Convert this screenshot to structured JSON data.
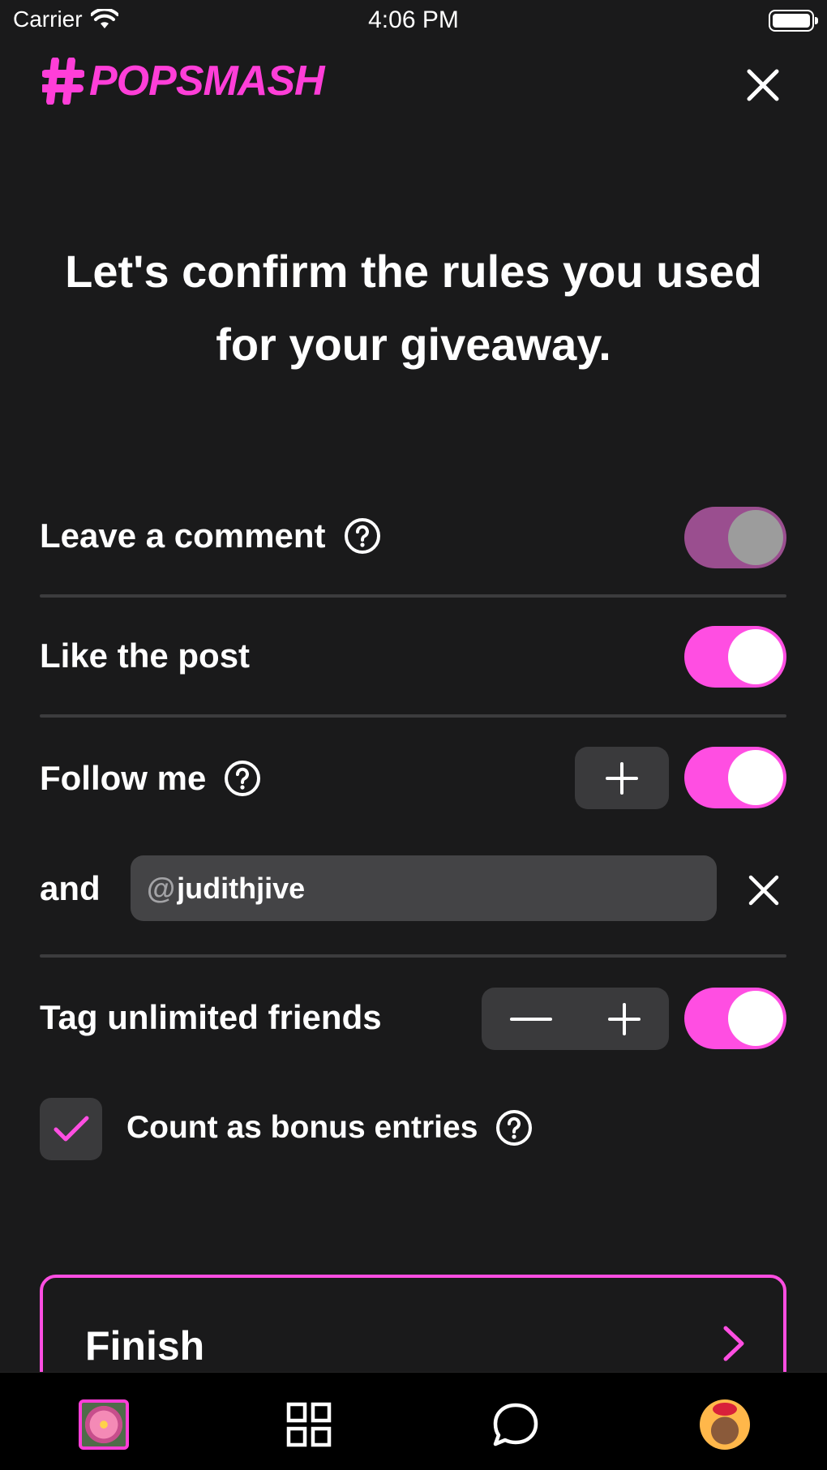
{
  "status_bar": {
    "carrier": "Carrier",
    "time": "4:06 PM"
  },
  "header": {
    "logo_text": "POPSMASH"
  },
  "headline": "Let's confirm the rules you used for your giveaway.",
  "rules": {
    "comment": {
      "label": "Leave a comment",
      "enabled": true,
      "locked": true
    },
    "like": {
      "label": "Like the post",
      "enabled": true
    },
    "follow": {
      "label": "Follow me",
      "enabled": true,
      "and_label": "and",
      "account_prefix": "@",
      "account_value": "judithjive"
    },
    "tag": {
      "label": "Tag unlimited friends",
      "enabled": true
    },
    "bonus": {
      "label": "Count as bonus entries",
      "checked": true
    }
  },
  "finish_button": {
    "label": "Finish"
  },
  "colors": {
    "accent": "#ff4ee2",
    "background": "#1a1a1b",
    "control_gray": "#3a3a3c"
  },
  "tab_bar": {
    "items": [
      {
        "icon": "giveaway-photo-thumbnail"
      },
      {
        "icon": "grid-icon"
      },
      {
        "icon": "chat-bubble-icon"
      },
      {
        "icon": "profile-avatar"
      }
    ]
  }
}
